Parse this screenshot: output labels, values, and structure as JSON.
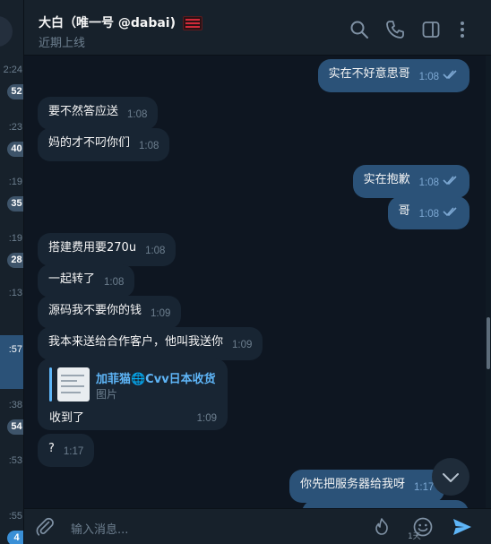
{
  "chat_list_strip": {
    "times": [
      "2:24",
      ":23",
      ":19",
      ":19",
      ":13",
      ":57",
      ":38",
      ":53",
      ":55"
    ],
    "badges": [
      "52",
      "40",
      "35",
      "28",
      "",
      "",
      "54",
      "",
      "4"
    ]
  },
  "header": {
    "title": "大白（唯一号 @dabai)",
    "status": "近期上线"
  },
  "icons": {
    "search": "search-icon",
    "call": "phone-icon",
    "sidebar": "sidebar-toggle-icon",
    "more": "more-vertical-icon",
    "attach": "paperclip-icon",
    "timer": "self-destruct-timer-icon",
    "emoji": "emoji-icon",
    "send": "send-icon",
    "scroll_down": "chevron-down-icon"
  },
  "messages": [
    {
      "dir": "out",
      "text": "实在不好意思哥",
      "time": "1:08",
      "read": true
    },
    {
      "dir": "in",
      "text": "要不然答应送",
      "time": "1:08"
    },
    {
      "dir": "in",
      "text": "妈的才不叼你们",
      "time": "1:08"
    },
    {
      "dir": "out",
      "text": "实在抱歉",
      "time": "1:08",
      "read": true
    },
    {
      "dir": "out",
      "text": "哥",
      "time": "1:08",
      "read": true
    },
    {
      "dir": "in",
      "text": "搭建费用要270u",
      "time": "1:08"
    },
    {
      "dir": "in",
      "text": "一起转了",
      "time": "1:08"
    },
    {
      "dir": "in",
      "text": "源码我不要你的钱",
      "time": "1:09"
    },
    {
      "dir": "in",
      "text": "我本来送给合作客户，他叫我送你",
      "time": "1:09"
    },
    {
      "dir": "in",
      "text": "?",
      "time": "1:17"
    },
    {
      "dir": "out",
      "text": "你先把服务器给我呀",
      "time": "1:17"
    }
  ],
  "reply_message": {
    "reply_to_name": "加菲猫🌐Cvv日本收货",
    "reply_to_type": "图片",
    "text": "收到了",
    "time": "1:09"
  },
  "composer": {
    "placeholder": "输入消息...",
    "timer_label": "1天"
  },
  "colors": {
    "background": "#0e1621",
    "panel": "#17212b",
    "incoming_bubble": "#182533",
    "outgoing_bubble": "#2b5278",
    "accent": "#5eb5f7",
    "muted_text": "#6d7f8f"
  }
}
